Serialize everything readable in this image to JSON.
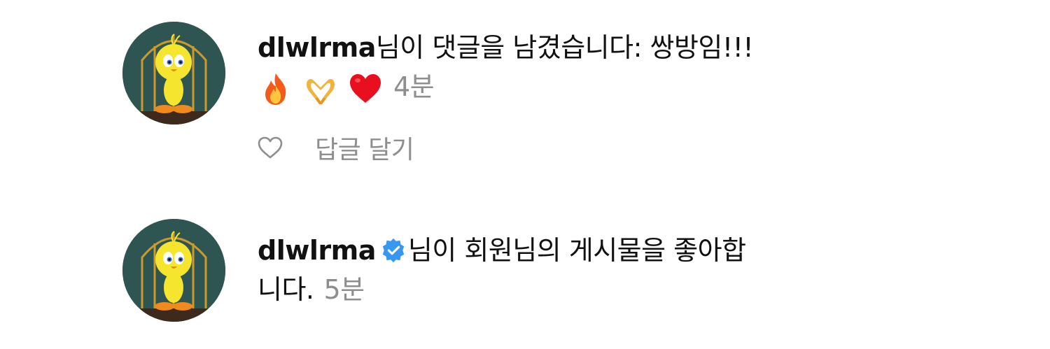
{
  "notifications": [
    {
      "username": "dlwlrma",
      "verified": false,
      "message": "님이 댓글을 남겼습니다: 쌍방임!!!",
      "emojis": [
        "fire-emoji",
        "heart-hands-emoji",
        "red-heart-emoji"
      ],
      "time": "4분",
      "actions": {
        "like_icon": "heart-outline-icon",
        "reply_label": "답글 달기"
      }
    },
    {
      "username": "dlwlrma",
      "verified": true,
      "message_line1": "님이 회원님의 게시물을 좋아합",
      "message_line2": "니다.",
      "time": "5분"
    }
  ],
  "colors": {
    "text": "#111111",
    "secondary": "#8e8e8e",
    "verified_blue": "#3897f0",
    "heart_red": "#e8101e"
  }
}
